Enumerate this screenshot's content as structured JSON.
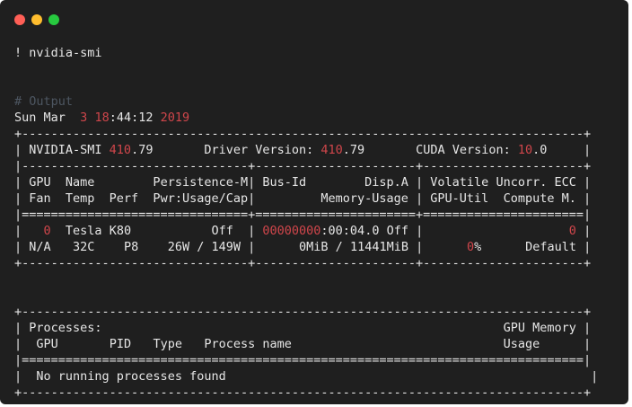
{
  "window": {
    "controls": [
      "close",
      "minimize",
      "zoom"
    ],
    "colors": {
      "close": "#ff5f56",
      "minimize": "#ffbd2e",
      "zoom": "#27c93f",
      "background": "#1f1f1f",
      "text": "#e6e6e6",
      "number": "#d0464b",
      "comment": "#4d5661"
    }
  },
  "command": "! nvidia-smi",
  "output_comment": "# Output",
  "timestamp": {
    "prefix": "Sun Mar  ",
    "day": "3",
    "space": " ",
    "hour": "18",
    "clock": ":44:12 ",
    "year": "2019"
  },
  "header": {
    "smi_label": "NVIDIA-SMI ",
    "smi_major": "410",
    "smi_minor": ".79",
    "driver_label": "Driver Version: ",
    "driver_major": "410",
    "driver_minor": ".79",
    "cuda_label": "CUDA Version: ",
    "cuda_major": "10",
    "cuda_minor": ".0"
  },
  "gpu_table": {
    "header_row1": "GPU  Name        Persistence-M| Bus-Id        Disp.A | Volatile Uncorr. ECC ",
    "header_row2": "Fan  Temp  Perf  Pwr:Usage/Cap|         Memory-Usage | GPU-Util  Compute M. ",
    "gpu": {
      "index": "0",
      "name": "Tesla K80",
      "persistence": "Off",
      "bus_id_prefix": "00000000",
      "bus_id_suffix": ":00:04.0",
      "disp": "Off",
      "ecc": "0",
      "fan": "N/A",
      "temp": "32C",
      "perf": "P8",
      "power": "26W / 149W",
      "memory": "0MiB / 11441MiB",
      "util_value": "0",
      "util_unit": "%",
      "compute_mode": "Default"
    }
  },
  "processes": {
    "title": "Processes:",
    "memory_header": "GPU Memory",
    "columns": [
      "GPU",
      "PID",
      "Type",
      "Process name"
    ],
    "usage_header": "Usage",
    "empty_message": "No running processes found"
  }
}
